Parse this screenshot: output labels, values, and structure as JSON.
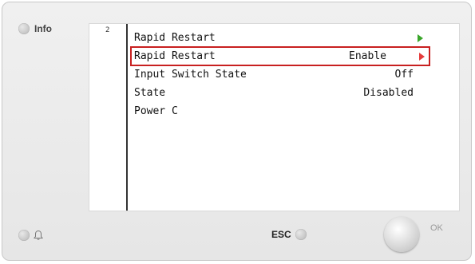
{
  "buttons": {
    "info_label": "Info",
    "esc_label": "ESC",
    "ok_label": "OK"
  },
  "screen": {
    "page_number": "2",
    "menu": [
      {
        "label": "Rapid Restart",
        "value": "",
        "arrow": true
      },
      {
        "label": "Rapid Restart",
        "value": "Enable",
        "arrow": true,
        "selected": true
      },
      {
        "label": "Input Switch State",
        "value": "Off"
      },
      {
        "label": "State",
        "value": "Disabled"
      },
      {
        "label": "Power C",
        "value": ""
      }
    ]
  },
  "icons": {
    "info": "round-button-icon",
    "bell": "bell-icon",
    "arrow": "triangle-right-icon"
  },
  "colors": {
    "highlight": "#c82020",
    "arrow_green": "#3aa62a",
    "arrow_red": "#e53c3c"
  }
}
